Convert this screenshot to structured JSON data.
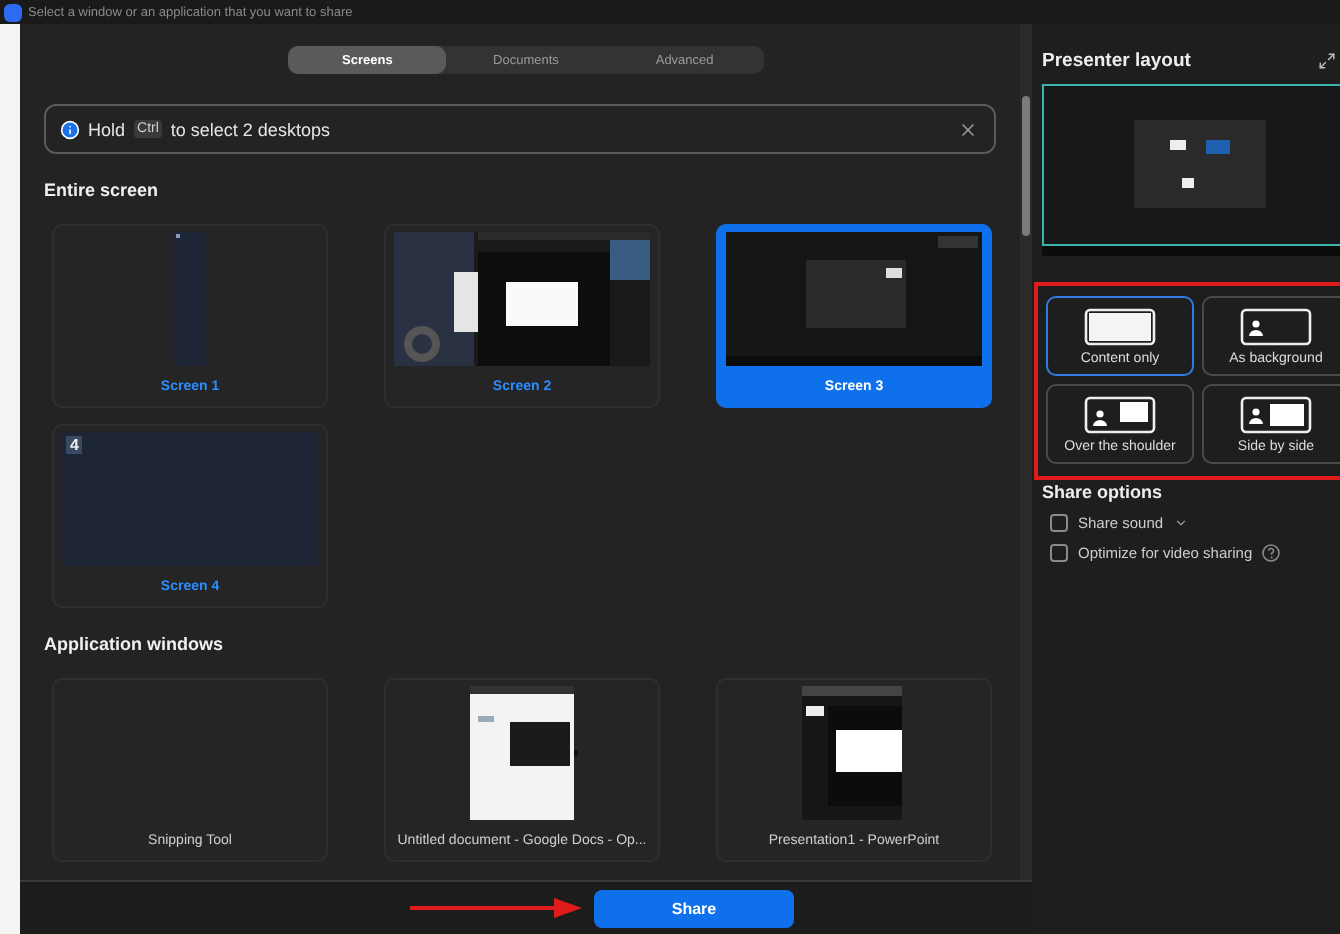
{
  "title_bar": {
    "text": "Select a window or an application that you want to share"
  },
  "tabs": [
    {
      "label": "Screens",
      "selected": true
    },
    {
      "label": "Documents",
      "selected": false
    },
    {
      "label": "Advanced",
      "selected": false
    }
  ],
  "notice": {
    "before": "Hold",
    "key": "Ctrl",
    "after": "to select 2 desktops"
  },
  "sections": [
    {
      "heading": "Entire screen",
      "kind": "screens",
      "items": [
        {
          "label": "Screen 1",
          "selected": false
        },
        {
          "label": "Screen 2",
          "selected": false
        },
        {
          "label": "Screen 3",
          "selected": true
        },
        {
          "label": "Screen 4",
          "selected": false,
          "badge": "4"
        }
      ]
    },
    {
      "heading": "Application windows",
      "kind": "apps",
      "items": [
        {
          "label": "Snipping Tool",
          "selected": false
        },
        {
          "label": "Untitled document - Google Docs - Op...",
          "selected": false
        },
        {
          "label": "Presentation1 - PowerPoint",
          "selected": false
        }
      ]
    }
  ],
  "share_button": "Share",
  "presenter_layout": {
    "title": "Presenter layout",
    "options": [
      {
        "label": "Content only",
        "kind": "content",
        "selected": true
      },
      {
        "label": "As background",
        "kind": "background",
        "selected": false
      },
      {
        "label": "Over the shoulder",
        "kind": "shoulder",
        "selected": false
      },
      {
        "label": "Side by side",
        "kind": "side",
        "selected": false
      }
    ]
  },
  "share_options": {
    "title": "Share options",
    "items": [
      {
        "label": "Share sound",
        "checked": false,
        "dropdown": true
      },
      {
        "label": "Optimize for video sharing",
        "checked": false,
        "help": true
      }
    ]
  }
}
